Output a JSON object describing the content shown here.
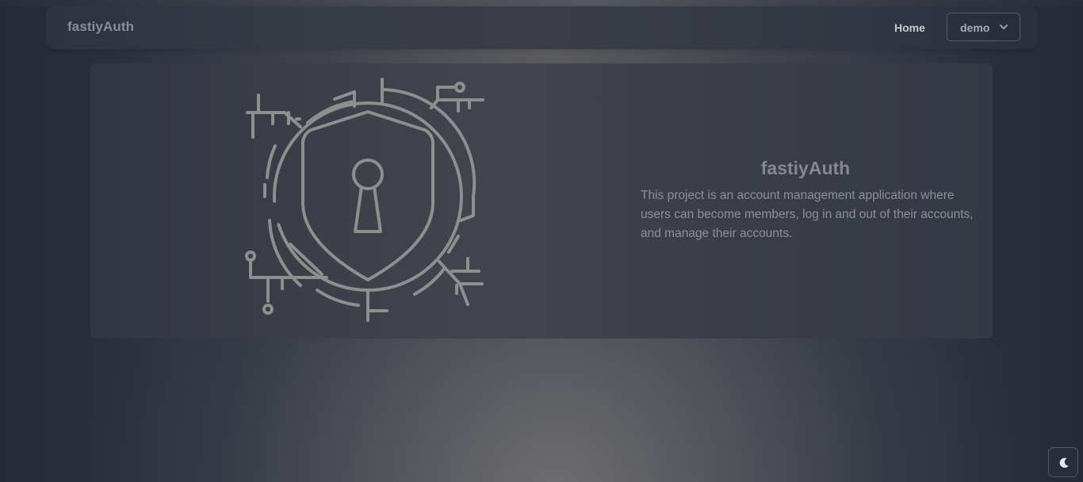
{
  "navbar": {
    "brand": "fastiyAuth",
    "home_label": "Home",
    "user_menu": {
      "selected": "demo",
      "icon": "chevron-down-icon"
    }
  },
  "hero": {
    "illustration_icon": "security-lock-shield-icon",
    "title": "fastiyAuth",
    "description": "This project is an account management application where users can become members, log in and out of their accounts, and manage their accounts."
  },
  "theme_toggle": {
    "icon": "moon-icon"
  },
  "colors": {
    "background": "#2b303d",
    "navbar": "#363a45",
    "hero_card": "#3e414a",
    "illustration_stroke": "#8f8f90",
    "title_text": "#85888d",
    "body_text": "#8d9096"
  }
}
